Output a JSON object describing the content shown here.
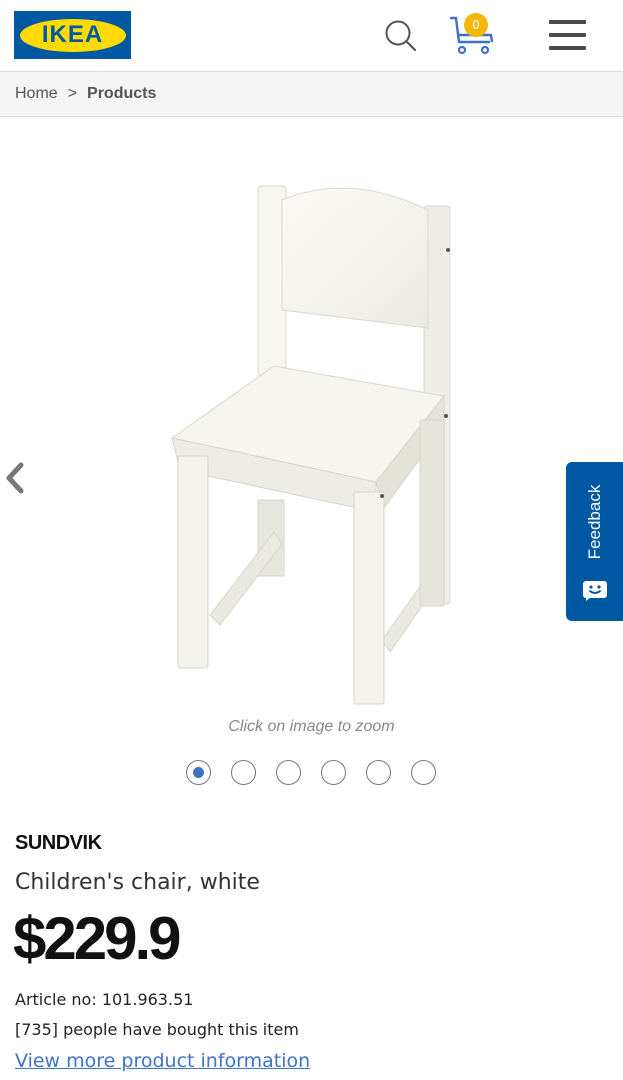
{
  "header": {
    "logo_text": "IKEA",
    "icons": {
      "search": "search-icon",
      "cart": "cart-icon",
      "menu": "hamburger-menu-icon"
    },
    "cart_count": "0"
  },
  "breadcrumb": {
    "home": "Home",
    "separator": ">",
    "current": "Products"
  },
  "gallery": {
    "zoom_hint": "Click on image to zoom",
    "image_count": 6,
    "active_index": 0,
    "prev_icon": "chevron-left-icon"
  },
  "feedback": {
    "label": "Feedback",
    "icon": "smile-chat-icon"
  },
  "product": {
    "name": "SUNDVIK",
    "description": "Children's chair, white",
    "price": "$229.9",
    "article": "Article no: 101.963.51",
    "bought": "[735] people have bought this item",
    "more_link": "View more product information"
  },
  "colors": {
    "brand_blue": "#0058a3",
    "brand_yellow": "#ffdb00",
    "link_blue": "#3f74c6",
    "badge": "#f5b50a"
  }
}
